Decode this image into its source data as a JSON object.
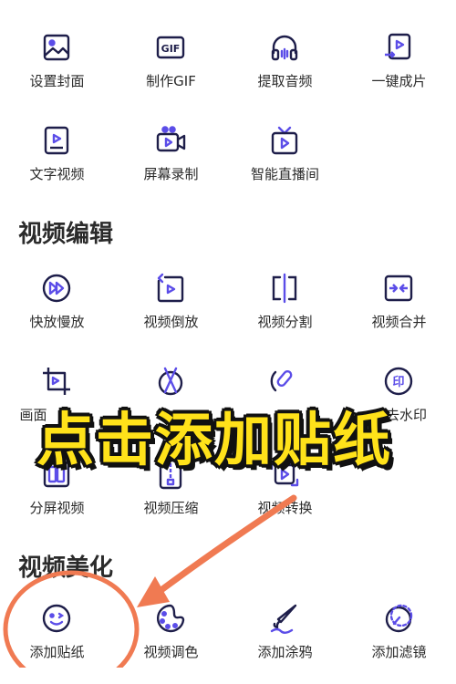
{
  "colors": {
    "icon_stroke": "#1e1e4a",
    "icon_accent": "#5b4de8",
    "overlay_text": "#ffe21a",
    "annotation": "#f07a52"
  },
  "row1": [
    {
      "label": "设置封面",
      "icon": "image-icon"
    },
    {
      "label": "制作GIF",
      "icon": "gif-icon"
    },
    {
      "label": "提取音频",
      "icon": "headphones-icon"
    },
    {
      "label": "一键成片",
      "icon": "video-export-icon"
    }
  ],
  "row2": [
    {
      "label": "文字视频",
      "icon": "text-video-icon"
    },
    {
      "label": "屏幕录制",
      "icon": "screen-record-icon"
    },
    {
      "label": "智能直播间",
      "icon": "live-tv-icon"
    }
  ],
  "section_edit": {
    "title": "视频编辑"
  },
  "row3": [
    {
      "label": "快放慢放",
      "icon": "speed-icon"
    },
    {
      "label": "视频倒放",
      "icon": "reverse-icon"
    },
    {
      "label": "视频分割",
      "icon": "split-icon"
    },
    {
      "label": "视频合并",
      "icon": "merge-icon"
    }
  ],
  "row4": [
    {
      "label": "画面",
      "icon": "crop-icon"
    },
    {
      "label": "",
      "icon": "cut-icon"
    },
    {
      "label": "",
      "icon": "magic-wand-icon"
    },
    {
      "label": "去水印",
      "icon": "watermark-icon"
    }
  ],
  "row5": [
    {
      "label": "分屏视频",
      "icon": "split-screen-icon"
    },
    {
      "label": "视频压缩",
      "icon": "compress-icon"
    },
    {
      "label": "视频转换",
      "icon": "convert-icon"
    }
  ],
  "section_beautify": {
    "title": "视频美化"
  },
  "row6": [
    {
      "label": "添加贴纸",
      "icon": "sticker-icon"
    },
    {
      "label": "视频调色",
      "icon": "palette-icon"
    },
    {
      "label": "添加涂鸦",
      "icon": "brush-icon"
    },
    {
      "label": "添加滤镜",
      "icon": "filter-icon"
    }
  ],
  "overlay": {
    "text": "点击添加贴纸"
  }
}
